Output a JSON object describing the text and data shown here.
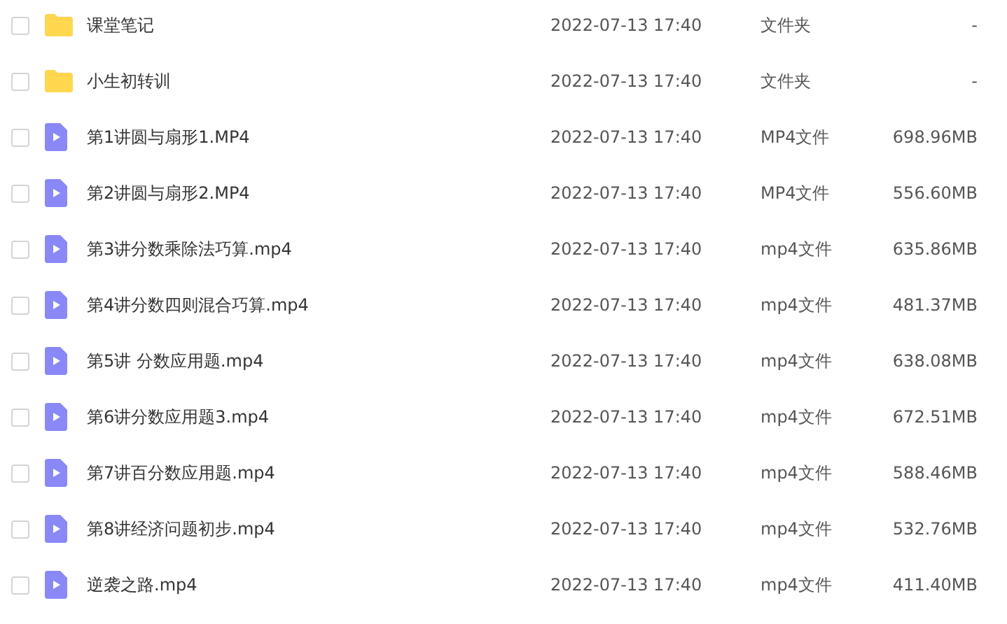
{
  "files": [
    {
      "kind": "folder",
      "checked": false,
      "name": "课堂笔记",
      "modified": "2022-07-13 17:40",
      "type": "文件夹",
      "size": "-"
    },
    {
      "kind": "folder",
      "checked": false,
      "name": "小生初转训",
      "modified": "2022-07-13 17:40",
      "type": "文件夹",
      "size": "-"
    },
    {
      "kind": "video",
      "checked": false,
      "name": "第1讲圆与扇形1.MP4",
      "modified": "2022-07-13 17:40",
      "type": "MP4文件",
      "size": "698.96MB"
    },
    {
      "kind": "video",
      "checked": false,
      "name": "第2讲圆与扇形2.MP4",
      "modified": "2022-07-13 17:40",
      "type": "MP4文件",
      "size": "556.60MB"
    },
    {
      "kind": "video",
      "checked": false,
      "name": "第3讲分数乘除法巧算.mp4",
      "modified": "2022-07-13 17:40",
      "type": "mp4文件",
      "size": "635.86MB"
    },
    {
      "kind": "video",
      "checked": false,
      "name": "第4讲分数四则混合巧算.mp4",
      "modified": "2022-07-13 17:40",
      "type": "mp4文件",
      "size": "481.37MB"
    },
    {
      "kind": "video",
      "checked": false,
      "name": "第5讲 分数应用题.mp4",
      "modified": "2022-07-13 17:40",
      "type": "mp4文件",
      "size": "638.08MB"
    },
    {
      "kind": "video",
      "checked": false,
      "name": "第6讲分数应用题3.mp4",
      "modified": "2022-07-13 17:40",
      "type": "mp4文件",
      "size": "672.51MB"
    },
    {
      "kind": "video",
      "checked": false,
      "name": "第7讲百分数应用题.mp4",
      "modified": "2022-07-13 17:40",
      "type": "mp4文件",
      "size": "588.46MB"
    },
    {
      "kind": "video",
      "checked": false,
      "name": "第8讲经济问题初步.mp4",
      "modified": "2022-07-13 17:40",
      "type": "mp4文件",
      "size": "532.76MB"
    },
    {
      "kind": "video",
      "checked": false,
      "name": "逆袭之路.mp4",
      "modified": "2022-07-13 17:40",
      "type": "mp4文件",
      "size": "411.40MB"
    }
  ]
}
